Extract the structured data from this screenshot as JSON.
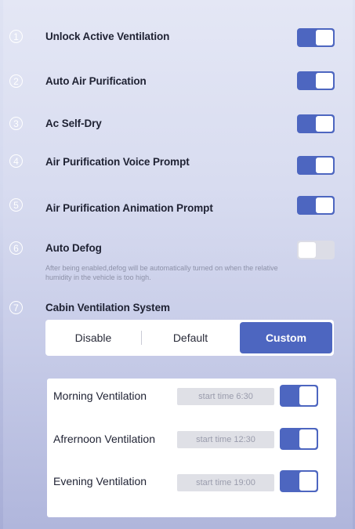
{
  "settings": [
    {
      "index": "1",
      "label": "Unlock Active Ventilation",
      "enabled": true
    },
    {
      "index": "2",
      "label": "Auto Air Purification",
      "enabled": true
    },
    {
      "index": "3",
      "label": "Ac Self-Dry",
      "enabled": true
    },
    {
      "index": "4",
      "label": "Air Purification Voice Prompt",
      "enabled": true
    },
    {
      "index": "5",
      "label": "Air Purification Animation Prompt",
      "enabled": true
    },
    {
      "index": "6",
      "label": "Auto Defog",
      "enabled": false,
      "description": "After being enabled,defog will be automatically turned on when the relative humidity in the vehicle is too high."
    },
    {
      "index": "7",
      "label": "Cabin Ventilation System"
    }
  ],
  "ventilation_mode": {
    "options": [
      "Disable",
      "Default",
      "Custom"
    ],
    "selected": "Custom"
  },
  "schedules": [
    {
      "label": "Morning Ventilation",
      "time": "start time 6:30",
      "enabled": true
    },
    {
      "label": "Afrernoon Ventilation",
      "time": "start time 12:30",
      "enabled": true
    },
    {
      "label": "Evening Ventilation",
      "time": "start time 19:00",
      "enabled": true
    }
  ],
  "colors": {
    "accent": "#4d66c0",
    "toggle_off": "#dcdde6"
  }
}
